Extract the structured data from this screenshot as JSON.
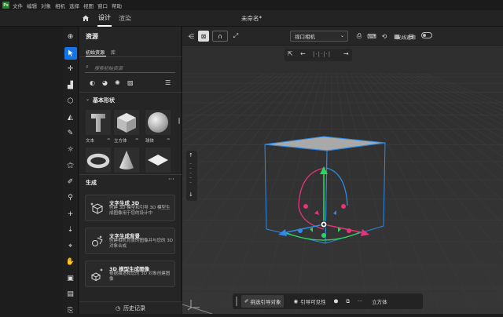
{
  "menubar": {
    "logo": "Ps",
    "items": [
      "文件",
      "编辑",
      "对象",
      "相机",
      "选择",
      "视图",
      "窗口",
      "帮助"
    ]
  },
  "tabs": {
    "design": "设计",
    "render": "渲染"
  },
  "doc_title": "未命名*",
  "panel": {
    "assets_title": "资源",
    "subtabs": {
      "starter": "初始资源",
      "library": "库"
    },
    "search_placeholder": "搜索初始资源",
    "basic_shapes_title": "基本形状",
    "shapes": [
      {
        "label": "文本",
        "icon": "text-shape-icon"
      },
      {
        "label": "立方体",
        "icon": "cube-shape-icon"
      },
      {
        "label": "球体",
        "icon": "sphere-shape-icon"
      },
      {
        "label": "",
        "icon": "torus-shape-icon"
      },
      {
        "label": "",
        "icon": "cone-shape-icon"
      },
      {
        "label": "",
        "icon": "plane-shape-icon"
      }
    ],
    "generate_title": "生成",
    "gen_items": [
      {
        "title": "文字生成 3D",
        "desc": "创建 3D 模型和引导 3D 模型生成图像用于您的设计中"
      },
      {
        "title": "文字生成背景",
        "desc": "创建相机背景的图像并与您的 3D 对象合成"
      },
      {
        "title": "3D 模型生成图像",
        "desc": "根据描述和您的 3D 对象创建图像"
      }
    ],
    "history": "历史记录"
  },
  "topbar": {
    "camera": "视口相机",
    "ray_tracing": "光线追踪"
  },
  "bottombar": {
    "pick": "挑选引导对象",
    "guide_vis": "引导可见性",
    "cube": "立方体"
  },
  "colors": {
    "accent": "#1473e6",
    "x_axis": "#e8337a",
    "y_axis": "#2bd45e",
    "z_axis": "#2e8ae6"
  }
}
